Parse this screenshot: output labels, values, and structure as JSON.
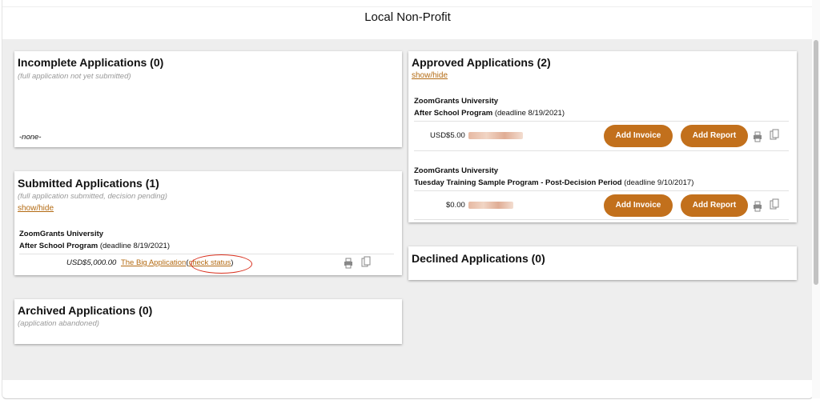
{
  "header": {
    "org_name": "Local Non-Profit"
  },
  "incomplete": {
    "title": "Incomplete Applications (0)",
    "subtitle": "(full application not yet submitted)",
    "none_label": "-none-"
  },
  "submitted": {
    "title": "Submitted Applications (1)",
    "subtitle": "(full application submitted, decision pending)",
    "toggle": "show/hide",
    "items": [
      {
        "organization": "ZoomGrants University",
        "program": "After School Program",
        "deadline": "(deadline 8/19/2021)",
        "amount": "USD$5,000.00",
        "app_link": "The Big Application",
        "open_paren": "(",
        "status_link": "check status",
        "close_paren": ")"
      }
    ]
  },
  "archived": {
    "title": "Archived Applications (0)",
    "subtitle": "(application abandoned)"
  },
  "approved": {
    "title": "Approved Applications (2)",
    "toggle": "show/hide",
    "add_invoice_label": "Add Invoice",
    "add_report_label": "Add Report",
    "items": [
      {
        "organization": "ZoomGrants University",
        "program": "After School Program",
        "deadline": "(deadline 8/19/2021)",
        "amount": "USD$5.00"
      },
      {
        "organization": "ZoomGrants University",
        "program": "Tuesday Training Sample Program - Post-Decision Period",
        "deadline": "(deadline 9/10/2017)",
        "amount": "$0.00"
      }
    ]
  },
  "declined": {
    "title": "Declined Applications (0)"
  },
  "icons": {
    "print": "printer-icon",
    "copy": "copy-icon"
  },
  "colors": {
    "accent": "#c2701c",
    "link": "#b36a12",
    "highlight": "#d9301e",
    "background": "#eeeeee"
  }
}
